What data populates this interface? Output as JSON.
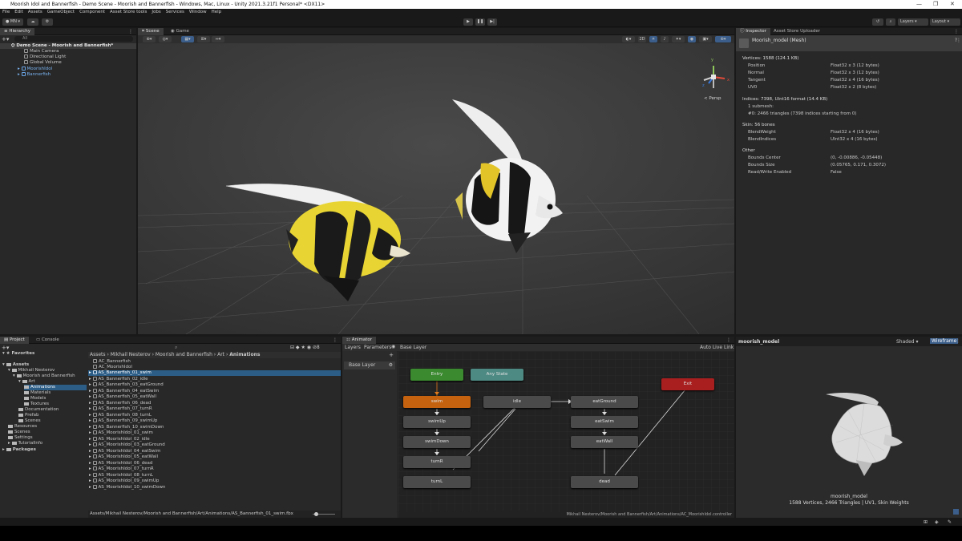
{
  "window": {
    "title": "Moorish Idol and Bannerfish - Demo Scene - Moorish and Bannerfish - Windows, Mac, Linux - Unity 2021.3.21f1 Personal* <DX11>"
  },
  "menu": [
    "File",
    "Edit",
    "Assets",
    "GameObject",
    "Component",
    "Asset Store tools",
    "Jobs",
    "Services",
    "Window",
    "Help"
  ],
  "toolbar": {
    "account": "MN",
    "layers": "Layers",
    "layout": "Layout"
  },
  "hierarchy": {
    "tab": "Hierarchy",
    "search": "All",
    "scene": "Demo Scene - Moorish and Bannerfish*",
    "items": [
      "Main Camera",
      "Directional Light",
      "Global Volume",
      "MoorishIdol",
      "Bannerfish"
    ]
  },
  "scene_view": {
    "tabs": [
      "Scene",
      "Game"
    ],
    "persp_label": "< Persp",
    "gizmo_axes": [
      "y",
      "x",
      "z"
    ]
  },
  "inspector": {
    "tabs": [
      "Inspector",
      "Asset Store Uploader"
    ],
    "object": "Moorish_model (Mesh)",
    "vertices_header": "Vertices: 1588 (124.1 KB)",
    "vertices": [
      {
        "k": "Position",
        "v": "Float32 x 3 (12 bytes)"
      },
      {
        "k": "Normal",
        "v": "Float32 x 3 (12 bytes)"
      },
      {
        "k": "Tangent",
        "v": "Float32 x 4 (16 bytes)"
      },
      {
        "k": "UV0",
        "v": "Float32 x 2 (8 bytes)"
      }
    ],
    "indices_header": "Indices: 7398, UInt16 format (14.4 KB)",
    "indices": [
      "1 submesh:",
      "#0: 2466 triangles (7398 indices starting from 0)"
    ],
    "skin_header": "Skin: 56 bones",
    "skin": [
      {
        "k": "BlendWeight",
        "v": "Float32 x 4 (16 bytes)"
      },
      {
        "k": "BlendIndices",
        "v": "UInt32 x 4 (16 bytes)"
      }
    ],
    "other_header": "Other",
    "other": [
      {
        "k": "Bounds Center",
        "v": "(0, -0.00886, -0.05448)"
      },
      {
        "k": "Bounds Size",
        "v": "(0.05765, 0.171, 0.3072)"
      },
      {
        "k": "Read/Write Enabled",
        "v": "False"
      }
    ]
  },
  "preview": {
    "title": "moorish_model",
    "shading": "Shaded",
    "wireframe": "Wireframe",
    "caption1": "moorish_model",
    "caption2": "1588 Vertices, 2466 Triangles | UV1, Skin Weights"
  },
  "project": {
    "tabs": [
      "Project",
      "Console"
    ],
    "favorites": "Favorites",
    "assets": "Assets",
    "tree": [
      "Mikhail Nesterov",
      "Moorish and Bannerfish",
      "Art",
      "Animations",
      "Materials",
      "Models",
      "Textures",
      "Documentation",
      "Prefab",
      "Scenes",
      "Resources",
      "Scenes",
      "Settings",
      "TutorialInfo"
    ],
    "packages": "Packages",
    "breadcrumb": [
      "Assets",
      "Mikhail Nesterov",
      "Moorish and Bannerfish",
      "Art",
      "Animations"
    ],
    "files": [
      "AC_Bannerfish",
      "AC_MoorishIdol",
      "AS_Bannerfish_01_swim",
      "AS_Bannerfish_02_idle",
      "AS_Bannerfish_03_eatGround",
      "AS_Bannerfish_04_eatSwim",
      "AS_Bannerfish_05_eatWall",
      "AS_Bannerfish_06_dead",
      "AS_Bannerfish_07_turnR",
      "AS_Bannerfish_08_turnL",
      "AS_Bannerfish_09_swimUp",
      "AS_Bannerfish_10_swimDown",
      "AS_MoorishIdol_01_swim",
      "AS_MoorishIdol_02_idle",
      "AS_MoorishIdol_03_eatGround",
      "AS_MoorishIdol_04_eatSwim",
      "AS_MoorishIdol_05_eatWall",
      "AS_MoorishIdol_06_dead",
      "AS_MoorishIdol_07_turnR",
      "AS_MoorishIdol_08_turnL",
      "AS_MoorishIdol_09_swimUp",
      "AS_MoorishIdol_10_swimDown"
    ],
    "path": "Assets/Mikhail Nesterov/Moorish and Bannerfish/Art/Animations/AS_Bannerfish_01_swim.fbx",
    "count": "8"
  },
  "animator": {
    "tab": "Animator",
    "subtabs": [
      "Layers",
      "Parameters"
    ],
    "layer_breadcrumb": "Base Layer",
    "layer_item": "Base Layer",
    "auto_live": "Auto Live Link",
    "path": "Mikhail Nesterov/Moorish and Bannerfish/Art/Animations/AC_MoorishIdol.controller",
    "nodes": {
      "entry": "Entry",
      "any": "Any State",
      "exit": "Exit",
      "swim": "swim",
      "swimUp": "swimUp",
      "swimDown": "swimDown",
      "turnR": "turnR",
      "turnL": "turnL",
      "idle": "idle",
      "eatGround": "eatGround",
      "eatSwim": "eatSwim",
      "eatWall": "eatWall",
      "dead": "dead"
    }
  },
  "colors": {
    "accent": "#2c5d87",
    "entry": "#3b8a2f",
    "any": "#4e8a84",
    "exit": "#a91f1f",
    "default_state": "#c5620f"
  }
}
